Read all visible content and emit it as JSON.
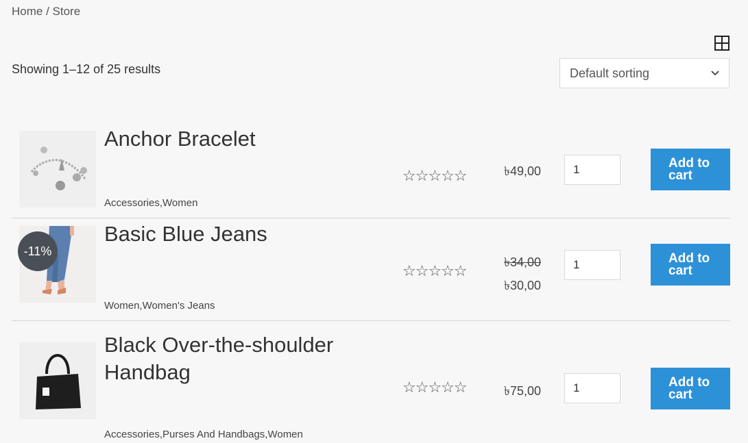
{
  "breadcrumb": "Home / Store",
  "result_count": "Showing 1–12 of 25 results",
  "sorting": {
    "selected": "Default sorting"
  },
  "icons": {
    "grid": "grid-view-icon",
    "star": "star-outline-icon",
    "chevron": "chevron-down-icon"
  },
  "colors": {
    "accent": "#2d91d8",
    "badge": "#4a4f57",
    "background": "#f7f7f7"
  },
  "products": [
    {
      "title": "Anchor Bracelet",
      "categories": "Accessories,Women",
      "rating_stars": "☆☆☆☆☆",
      "price": "৳49,00",
      "quantity": "1",
      "button": "Add to cart"
    },
    {
      "title": "Basic Blue Jeans",
      "badge": "-11%",
      "categories": "Women,Women's Jeans",
      "rating_stars": "☆☆☆☆☆",
      "old_price": "৳34,00",
      "price": "৳30,00",
      "quantity": "1",
      "button": "Add to cart"
    },
    {
      "title": "Black Over-the-shoulder Handbag",
      "categories": "Accessories,Purses And Handbags,Women",
      "rating_stars": "☆☆☆☆☆",
      "price": "৳75,00",
      "quantity": "1",
      "button": "Add to cart"
    }
  ]
}
